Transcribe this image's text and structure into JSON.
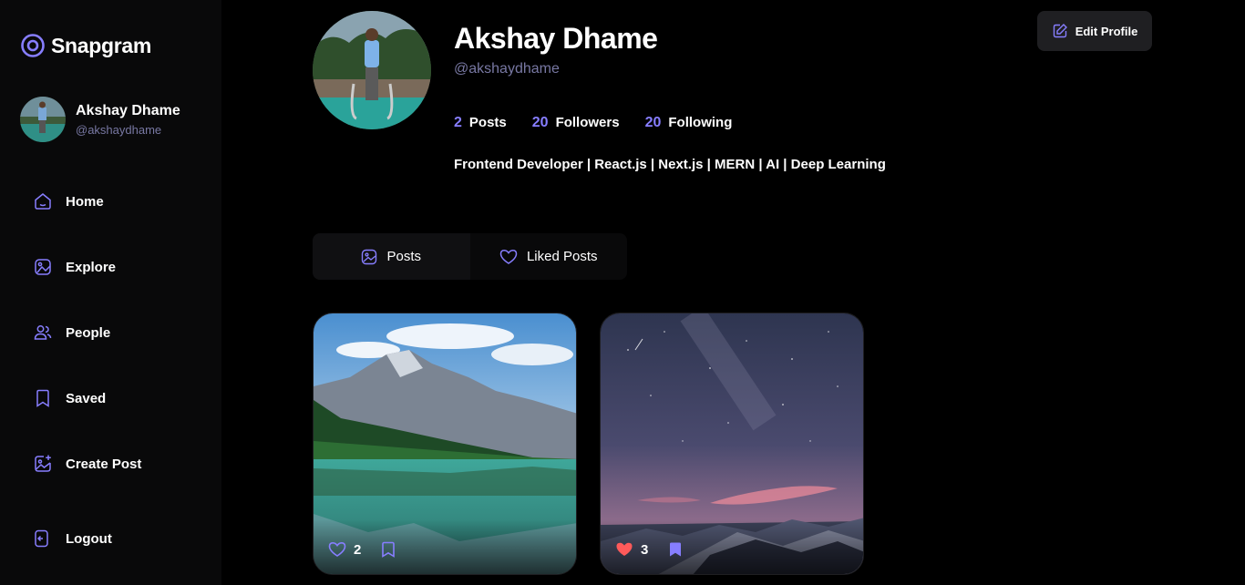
{
  "app": {
    "title": "Snapgram"
  },
  "sidebar": {
    "user": {
      "name": "Akshay Dhame",
      "handle": "@akshaydhame"
    },
    "nav": [
      {
        "label": "Home",
        "icon": "home-icon"
      },
      {
        "label": "Explore",
        "icon": "explore-icon"
      },
      {
        "label": "People",
        "icon": "people-icon"
      },
      {
        "label": "Saved",
        "icon": "saved-icon"
      },
      {
        "label": "Create Post",
        "icon": "create-post-icon"
      }
    ],
    "logout": {
      "label": "Logout",
      "icon": "logout-icon"
    }
  },
  "profile": {
    "name": "Akshay Dhame",
    "handle": "@akshaydhame",
    "edit_label": "Edit Profile",
    "stats": {
      "posts": {
        "value": "2",
        "label": "Posts"
      },
      "followers": {
        "value": "20",
        "label": "Followers"
      },
      "following": {
        "value": "20",
        "label": "Following"
      }
    },
    "bio": "Frontend Developer | React.js | Next.js | MERN | AI | Deep Learning"
  },
  "tabs": [
    {
      "label": "Posts",
      "icon": "posts-icon",
      "active": true
    },
    {
      "label": "Liked Posts",
      "icon": "heart-icon",
      "active": false
    }
  ],
  "posts": [
    {
      "likes": "2",
      "liked": false,
      "saved": false
    },
    {
      "likes": "3",
      "liked": true,
      "saved": true
    }
  ],
  "colors": {
    "accent": "#877eff",
    "like": "#ff5a5a",
    "muted": "#7878a3",
    "sidebar": "#09090a"
  }
}
